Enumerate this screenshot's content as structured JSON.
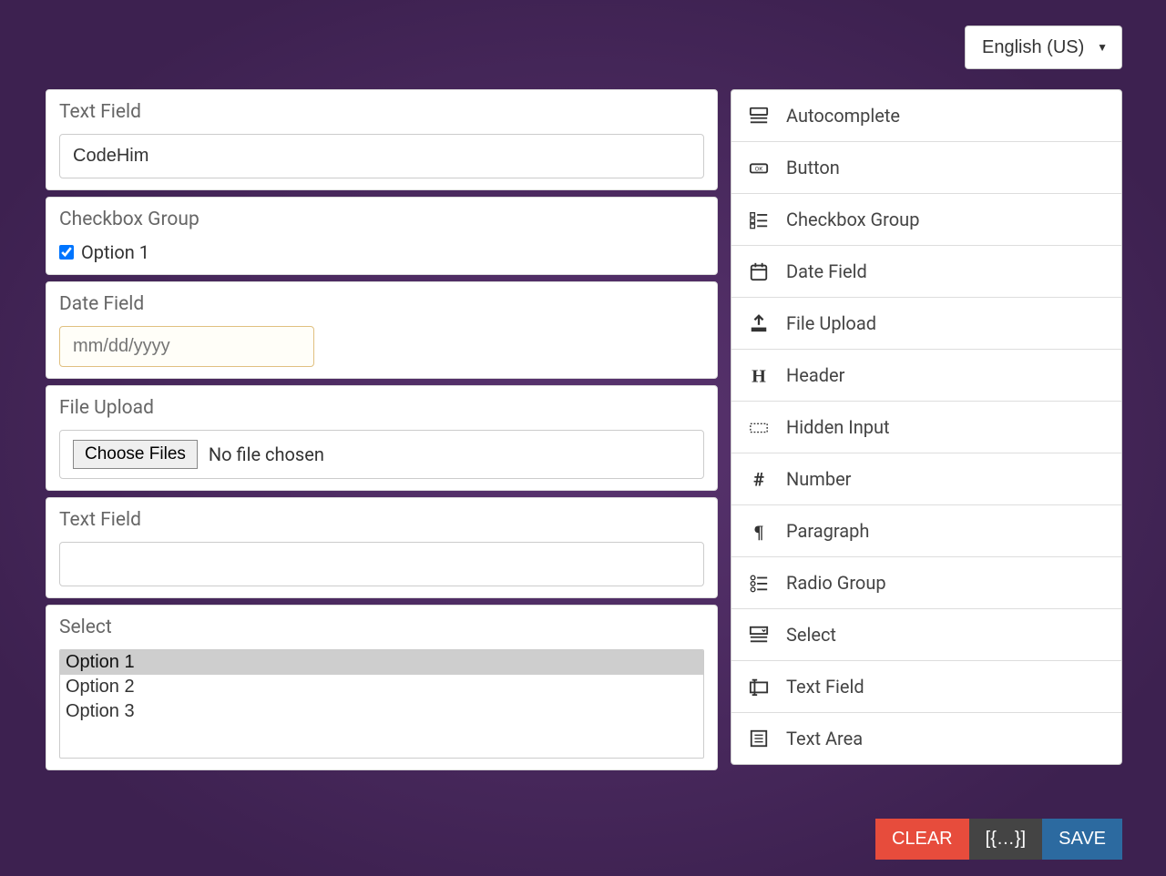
{
  "language": {
    "selected": "English (US)"
  },
  "fields": {
    "text1": {
      "label": "Text Field",
      "value": "CodeHim"
    },
    "checkbox": {
      "label": "Checkbox Group",
      "option": "Option 1",
      "checked": true
    },
    "date": {
      "label": "Date Field",
      "placeholder": "mm/dd/yyyy"
    },
    "file": {
      "label": "File Upload",
      "button": "Choose Files",
      "status": "No file chosen"
    },
    "text2": {
      "label": "Text Field",
      "value": ""
    },
    "select": {
      "label": "Select",
      "options": [
        "Option 1",
        "Option 2",
        "Option 3"
      ],
      "selected": "Option 1"
    }
  },
  "palette": [
    {
      "icon": "autocomplete",
      "label": "Autocomplete"
    },
    {
      "icon": "button",
      "label": "Button"
    },
    {
      "icon": "checkbox-group",
      "label": "Checkbox Group"
    },
    {
      "icon": "date",
      "label": "Date Field"
    },
    {
      "icon": "upload",
      "label": "File Upload"
    },
    {
      "icon": "header",
      "label": "Header"
    },
    {
      "icon": "hidden",
      "label": "Hidden Input"
    },
    {
      "icon": "number",
      "label": "Number"
    },
    {
      "icon": "paragraph",
      "label": "Paragraph"
    },
    {
      "icon": "radio-group",
      "label": "Radio Group"
    },
    {
      "icon": "select",
      "label": "Select"
    },
    {
      "icon": "text-field",
      "label": "Text Field"
    },
    {
      "icon": "textarea",
      "label": "Text Area"
    }
  ],
  "actions": {
    "clear": "CLEAR",
    "data": "[{…}]",
    "save": "SAVE"
  }
}
